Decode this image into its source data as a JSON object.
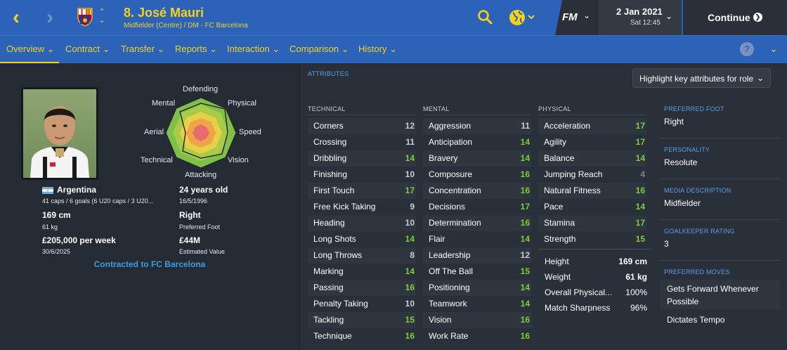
{
  "header": {
    "title": "8. José Mauri",
    "subtitle": "Midfielder (Centre) / DM - FC Barcelona",
    "game_logo": "FM",
    "date": "2 Jan 2021",
    "time": "Sat 12:45",
    "continue_label": "Continue",
    "icons": {
      "back": "chevron-left-icon",
      "forward": "chevron-right-icon",
      "search": "search-icon",
      "globe": "globe-icon",
      "continue": "arrow-right-circle-icon"
    },
    "colors": {
      "bar": "#2c63b8",
      "accent": "#f3d21c"
    }
  },
  "tabs": [
    {
      "label": "Overview",
      "active": true
    },
    {
      "label": "Contract"
    },
    {
      "label": "Transfer"
    },
    {
      "label": "Reports"
    },
    {
      "label": "Interaction"
    },
    {
      "label": "Comparison"
    },
    {
      "label": "History"
    }
  ],
  "help_label": "?",
  "profile": {
    "radar_labels": {
      "top": "Defending",
      "top_right": "Physical",
      "right": "Speed",
      "bottom_right": "Vision",
      "bottom": "Attacking",
      "bottom_left": "Technical",
      "left": "Aerial",
      "top_left": "Mental"
    },
    "nationality": "Argentina",
    "caps": "41 caps / 6 goals (6 U20 caps / 3 U20...",
    "age": "24 years old",
    "dob": "16/5/1996",
    "height": "169 cm",
    "weight": "61 kg",
    "preferred_foot": "Right",
    "preferred_foot_label": "Preferred Foot",
    "wage": "£205,000 per week",
    "contract_expiry": "30/6/2025",
    "value": "£44M",
    "value_label": "Estimated Value",
    "contract_link": "Contracted to FC Barcelona"
  },
  "attributes": {
    "section_title": "ATTRIBUTES",
    "highlight_dropdown": "Highlight key attributes for role",
    "technical": {
      "title": "TECHNICAL",
      "items": [
        {
          "name": "Corners",
          "value": "12"
        },
        {
          "name": "Crossing",
          "value": "11"
        },
        {
          "name": "Dribbling",
          "value": "14"
        },
        {
          "name": "Finishing",
          "value": "10"
        },
        {
          "name": "First Touch",
          "value": "17"
        },
        {
          "name": "Free Kick Taking",
          "value": "9"
        },
        {
          "name": "Heading",
          "value": "10"
        },
        {
          "name": "Long Shots",
          "value": "14"
        },
        {
          "name": "Long Throws",
          "value": "8"
        },
        {
          "name": "Marking",
          "value": "14"
        },
        {
          "name": "Passing",
          "value": "16"
        },
        {
          "name": "Penalty Taking",
          "value": "10"
        },
        {
          "name": "Tackling",
          "value": "15"
        },
        {
          "name": "Technique",
          "value": "16"
        }
      ]
    },
    "mental": {
      "title": "MENTAL",
      "items": [
        {
          "name": "Aggression",
          "value": "11"
        },
        {
          "name": "Anticipation",
          "value": "14"
        },
        {
          "name": "Bravery",
          "value": "14"
        },
        {
          "name": "Composure",
          "value": "16"
        },
        {
          "name": "Concentration",
          "value": "16"
        },
        {
          "name": "Decisions",
          "value": "17"
        },
        {
          "name": "Determination",
          "value": "16"
        },
        {
          "name": "Flair",
          "value": "14"
        },
        {
          "name": "Leadership",
          "value": "12"
        },
        {
          "name": "Off The Ball",
          "value": "15"
        },
        {
          "name": "Positioning",
          "value": "14"
        },
        {
          "name": "Teamwork",
          "value": "14"
        },
        {
          "name": "Vision",
          "value": "16"
        },
        {
          "name": "Work Rate",
          "value": "16"
        }
      ]
    },
    "physical": {
      "title": "PHYSICAL",
      "items": [
        {
          "name": "Acceleration",
          "value": "17"
        },
        {
          "name": "Agility",
          "value": "17"
        },
        {
          "name": "Balance",
          "value": "14"
        },
        {
          "name": "Jumping Reach",
          "value": "4"
        },
        {
          "name": "Natural Fitness",
          "value": "16"
        },
        {
          "name": "Pace",
          "value": "14"
        },
        {
          "name": "Stamina",
          "value": "17"
        },
        {
          "name": "Strength",
          "value": "15"
        }
      ],
      "stats": [
        {
          "name": "Height",
          "value": "169 cm",
          "bold": true
        },
        {
          "name": "Weight",
          "value": "61 kg",
          "bold": true
        },
        {
          "name": "Overall Physical...",
          "value": "100%"
        },
        {
          "name": "Match Sharpness",
          "value": "96%"
        }
      ]
    }
  },
  "sidebar": {
    "preferred_foot": {
      "heading": "PREFERRED FOOT",
      "value": "Right"
    },
    "personality": {
      "heading": "PERSONALITY",
      "value": "Resolute"
    },
    "media_description": {
      "heading": "MEDIA DESCRIPTION",
      "value": "Midfielder"
    },
    "goalkeeper_rating": {
      "heading": "GOALKEEPER RATING",
      "value": "3"
    },
    "preferred_moves": {
      "heading": "PREFERRED MOVES",
      "items": [
        "Gets Forward Whenever Possible",
        "Dictates Tempo"
      ]
    }
  }
}
